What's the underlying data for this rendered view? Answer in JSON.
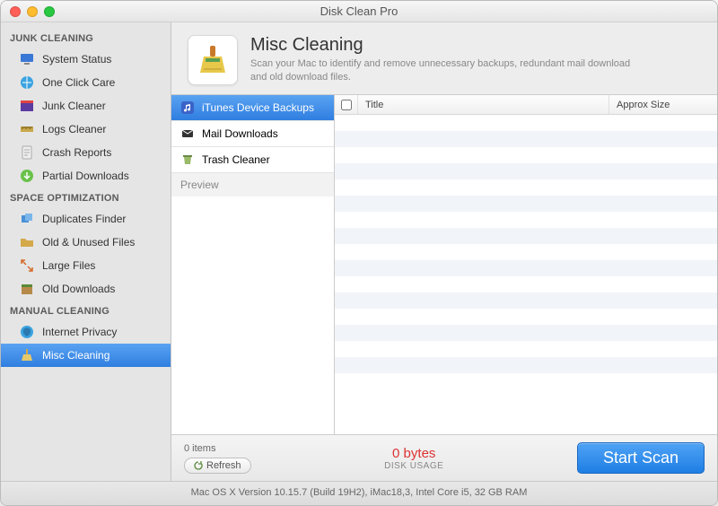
{
  "window": {
    "title": "Disk Clean Pro"
  },
  "sidebar": {
    "sections": [
      {
        "header": "JUNK CLEANING",
        "items": [
          {
            "label": "System Status",
            "icon": "monitor-icon"
          },
          {
            "label": "One Click Care",
            "icon": "globe-icon"
          },
          {
            "label": "Junk Cleaner",
            "icon": "clapper-icon"
          },
          {
            "label": "Logs Cleaner",
            "icon": "ruler-icon"
          },
          {
            "label": "Crash Reports",
            "icon": "document-icon"
          },
          {
            "label": "Partial Downloads",
            "icon": "download-icon"
          }
        ]
      },
      {
        "header": "SPACE OPTIMIZATION",
        "items": [
          {
            "label": "Duplicates Finder",
            "icon": "duplicates-icon"
          },
          {
            "label": "Old & Unused Files",
            "icon": "folder-icon"
          },
          {
            "label": "Large Files",
            "icon": "maximize-icon"
          },
          {
            "label": "Old Downloads",
            "icon": "box-icon"
          }
        ]
      },
      {
        "header": "MANUAL CLEANING",
        "items": [
          {
            "label": "Internet Privacy",
            "icon": "globe-shield-icon"
          },
          {
            "label": "Misc Cleaning",
            "icon": "broom-icon",
            "selected": true
          }
        ]
      }
    ]
  },
  "main": {
    "title": "Misc Cleaning",
    "description": "Scan your Mac to identify and remove unnecessary backups, redundant mail download and old download files.",
    "subitems": [
      {
        "label": "iTunes Device Backups",
        "icon": "music-icon",
        "selected": true
      },
      {
        "label": "Mail Downloads",
        "icon": "mail-icon"
      },
      {
        "label": "Trash Cleaner",
        "icon": "trash-icon"
      }
    ],
    "preview_label": "Preview",
    "table": {
      "columns": {
        "title": "Title",
        "size": "Approx Size"
      },
      "rows": []
    }
  },
  "footer": {
    "items_label": "0 items",
    "refresh_label": "Refresh",
    "usage_value": "0 bytes",
    "usage_label": "DISK USAGE",
    "scan_label": "Start Scan"
  },
  "statusbar": "Mac OS X Version 10.15.7 (Build 19H2), iMac18,3, Intel Core i5, 32 GB RAM"
}
